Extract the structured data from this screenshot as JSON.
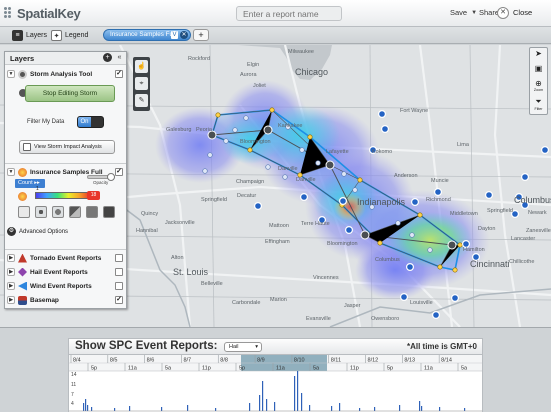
{
  "header": {
    "logo": "SpatialKey",
    "report_placeholder": "Enter a report name",
    "save_label": "Save",
    "share_label": "Share",
    "close_label": "Close"
  },
  "tabbar": {
    "layers_label": "Layers",
    "legend_label": "Legend",
    "active_tab": "Insurance Samples Full",
    "active_tab_badge": "V",
    "add_label": "+"
  },
  "map_labels": {
    "cities_large": [
      "Chicago",
      "Indianapolis",
      "Cincinnati",
      "Columbus",
      "St. Louis"
    ],
    "cities_small": [
      "Milwaukee",
      "Rockford",
      "Elgin",
      "Aurora",
      "Joliet",
      "Peoria",
      "Galesburg",
      "Bloomington",
      "Champaign",
      "Springfield",
      "Decatur",
      "Danville",
      "Muncie",
      "Richmond",
      "Dayton",
      "Springfield",
      "Terre Haute",
      "Bloomington",
      "Columbus",
      "Middletown",
      "Hamilton",
      "Evansville",
      "Owensboro",
      "Carbondale",
      "Vincennes",
      "Jasper",
      "Marion",
      "Lafayette",
      "Kokomo",
      "Fort Wayne",
      "Anderson",
      "Lima",
      "Zanesville",
      "Newark",
      "Lancaster",
      "Chillicothe",
      "Louisville",
      "Quincy",
      "Hannibal",
      "Jacksonville",
      "Belleville",
      "Alton",
      "Effingham",
      "Mattoon",
      "Danville",
      "Kankakee"
    ]
  },
  "map_tools": {
    "left": [
      "pointer-icon",
      "lasso-icon",
      "brush-icon"
    ],
    "right": [
      "arrow-icon",
      "zoom-box-icon",
      "zoom-icon",
      "filter-icon"
    ],
    "zoom_label": "Zoom",
    "filter_label": "Filter"
  },
  "layers_panel": {
    "title": "Layers",
    "storm_tool": {
      "label": "Storm Analysis Tool",
      "checked": true,
      "stop_button": "Stop Editing Storm",
      "filter_label": "Filter My Data",
      "toggle_value": "On",
      "view_button": "View Storm Impact Analysis"
    },
    "insurance": {
      "label": "Insurance Samples Full",
      "checked": true,
      "count_label": "Count",
      "opacity_label": "Opacity",
      "gradient_min": "1",
      "gradient_max": "18",
      "advanced_label": "Advanced Options"
    },
    "layers": [
      {
        "label": "Tornado Event Reports",
        "checked": false,
        "color": "#c0392b"
      },
      {
        "label": "Hail Event Reports",
        "checked": false,
        "color": "#8e44ad"
      },
      {
        "label": "Wind Event Reports",
        "checked": false,
        "color": "#2e86de"
      },
      {
        "label": "Basemap",
        "checked": true,
        "color": "#555555"
      }
    ]
  },
  "timeline": {
    "title": "Show SPC Event Reports:",
    "selected_type": "Hail",
    "gmt_note": "*All time is GMT+0",
    "dates": [
      "8/4",
      "8/5",
      "8/6",
      "8/7",
      "8/8",
      "8/9",
      "8/10",
      "8/11",
      "8/12",
      "8/13",
      "8/14"
    ],
    "hour_labels": [
      "5p",
      "11a",
      "5a",
      "11p",
      "5p",
      "11a",
      "5a",
      "11p",
      "5p",
      "11a",
      "5a"
    ],
    "y_ticks": [
      "14",
      "11",
      "7",
      "4"
    ]
  }
}
